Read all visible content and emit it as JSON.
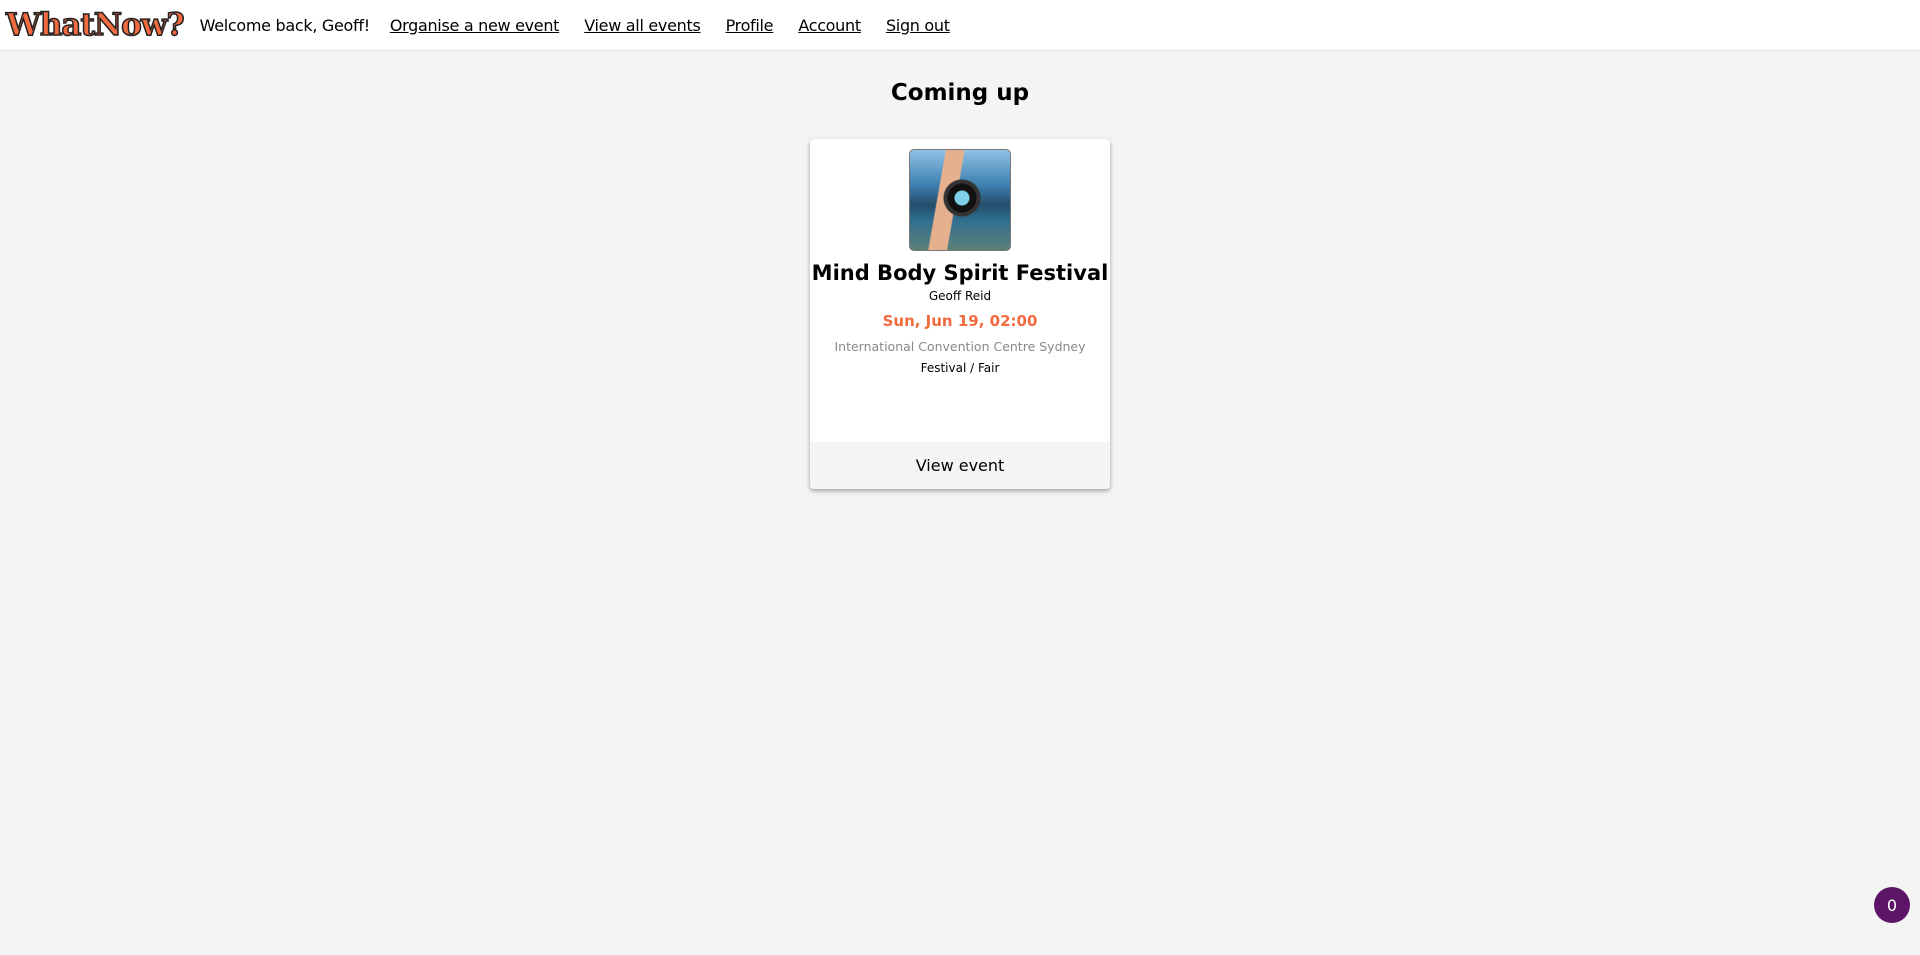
{
  "header": {
    "logo": "WhatNow?",
    "welcome": "Welcome back, Geoff!",
    "nav": [
      "Organise a new event",
      "View all events",
      "Profile",
      "Account",
      "Sign out"
    ]
  },
  "main": {
    "heading": "Coming up",
    "events": [
      {
        "image": "hand-holding-lens-lake-photo",
        "title": "Mind Body Spirit Festival",
        "organiser": "Geoff Reid",
        "date": "Sun, Jun 19, 02:00",
        "venue": "International Convention Centre Sydney",
        "category": "Festival / Fair",
        "button": "View event"
      }
    ]
  },
  "badge": {
    "count": "0",
    "color": "#5c1566"
  },
  "colors": {
    "accent": "#f26a3f",
    "background": "#f4f4f4"
  }
}
